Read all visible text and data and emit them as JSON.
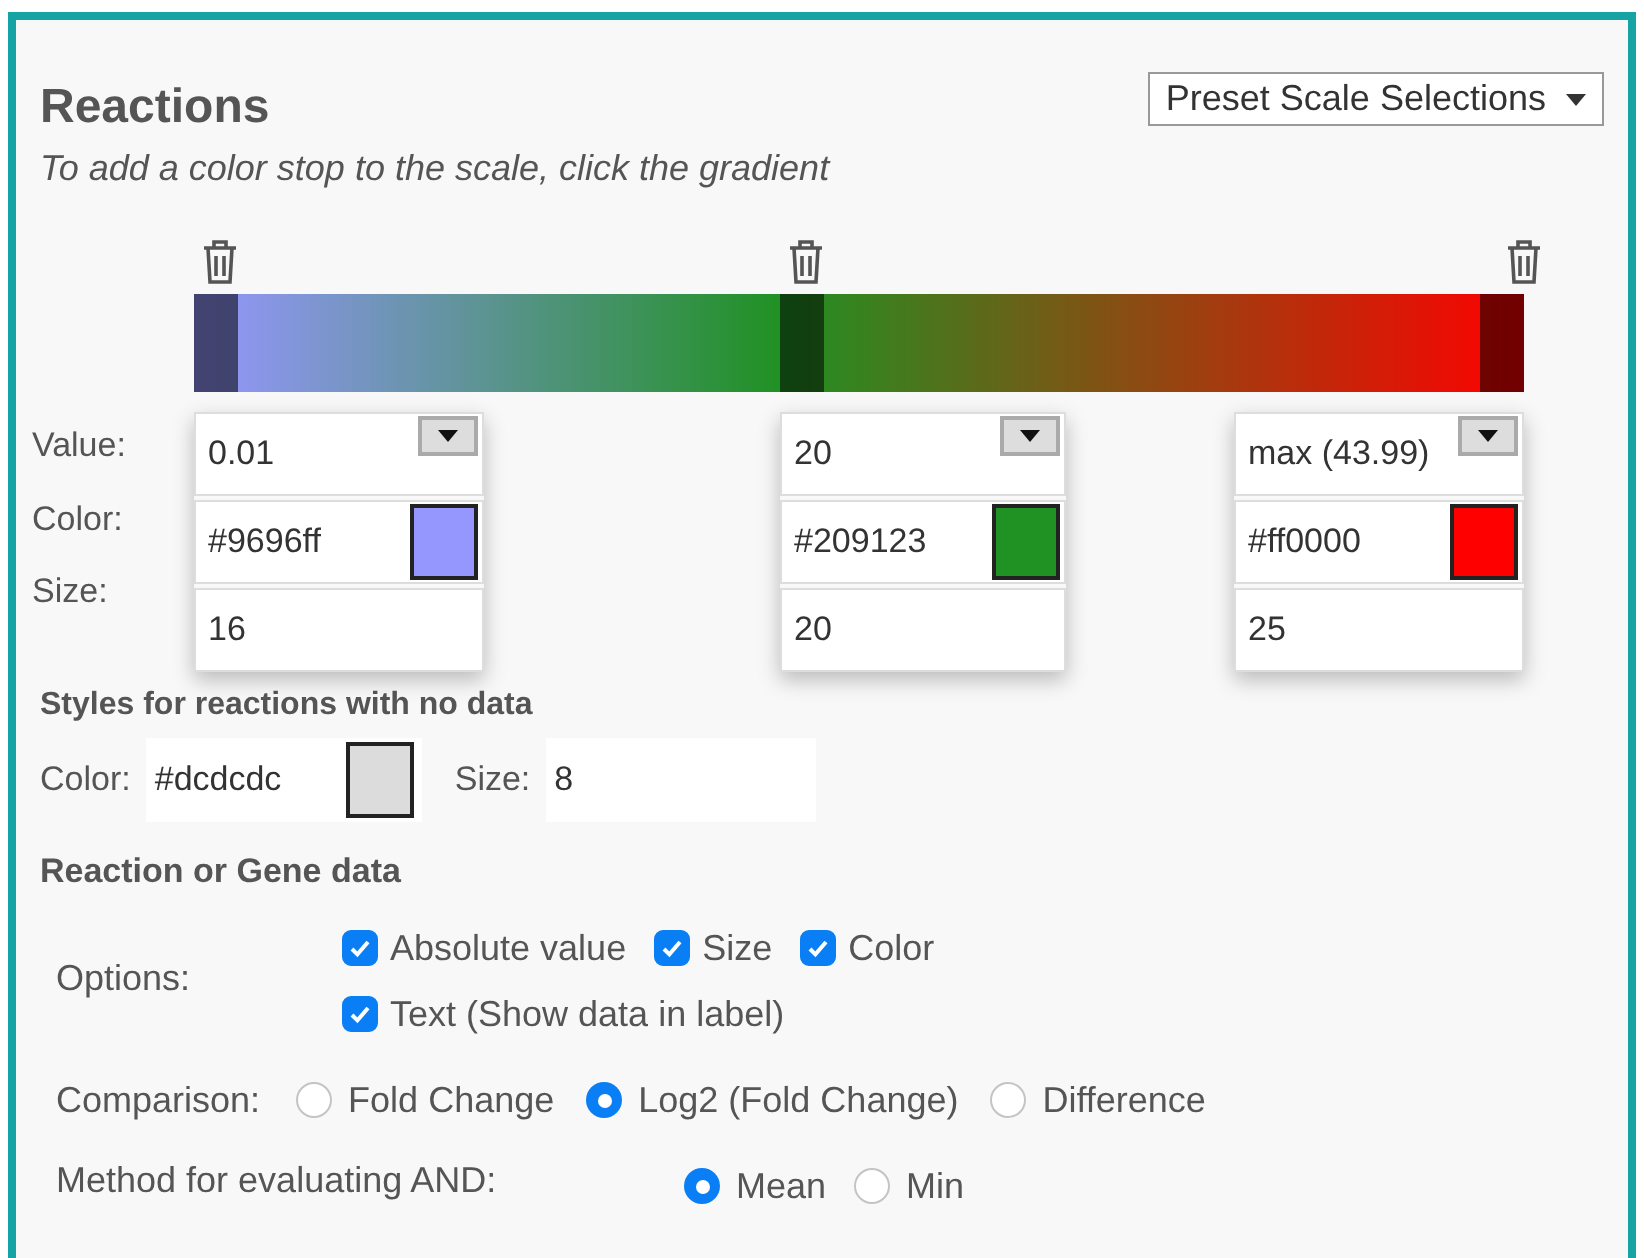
{
  "title": "Reactions",
  "preset_dropdown": {
    "label": "Preset Scale Selections"
  },
  "hint": "To add a color stop to the scale, click the gradient",
  "stop_labels": [
    "Value:",
    "Color:",
    "Size:"
  ],
  "stops": [
    {
      "value": "0.01",
      "color_text": "#9696ff",
      "color": "#9696ff",
      "size": "16"
    },
    {
      "value": "20",
      "color_text": "#209123",
      "color": "#209123",
      "size": "20"
    },
    {
      "value": "max (43.99)",
      "color_text": "#ff0000",
      "color": "#ff0000",
      "size": "25"
    }
  ],
  "no_data": {
    "heading": "Styles for reactions with no data",
    "color_label": "Color:",
    "color_text": "#dcdcdc",
    "color": "#dcdcdc",
    "size_label": "Size:",
    "size": "8"
  },
  "data_section": {
    "heading": "Reaction or Gene data",
    "options_label": "Options:",
    "options": [
      {
        "label": "Absolute value",
        "checked": true
      },
      {
        "label": "Size",
        "checked": true
      },
      {
        "label": "Color",
        "checked": true
      },
      {
        "label": "Text (Show data in label)",
        "checked": true
      }
    ],
    "comparison_label": "Comparison:",
    "comparison": [
      {
        "label": "Fold Change",
        "selected": false
      },
      {
        "label": "Log2 (Fold Change)",
        "selected": true
      },
      {
        "label": "Difference",
        "selected": false
      }
    ],
    "and_label": "Method for evaluating AND:",
    "and_methods": [
      {
        "label": "Mean",
        "selected": true
      },
      {
        "label": "Min",
        "selected": false
      }
    ]
  }
}
